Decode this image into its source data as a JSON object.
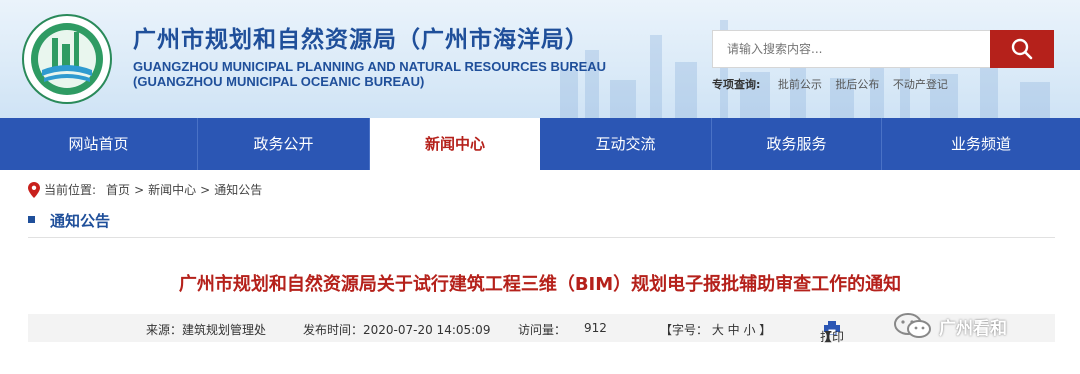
{
  "header": {
    "title_cn": "广州市规划和自然资源局（广州市海洋局）",
    "title_en_line1": "GUANGZHOU MUNICIPAL PLANNING AND NATURAL RESOURCES BUREAU",
    "title_en_line2": "(GUANGZHOU MUNICIPAL OCEANIC BUREAU)",
    "logo_icon": "bureau-emblem-icon"
  },
  "search": {
    "placeholder": "请输入搜索内容...",
    "button_icon": "search-icon",
    "button_color": "#b5211b"
  },
  "special_query": {
    "label": "专项查询:",
    "links": [
      "批前公示",
      "批后公布",
      "不动产登记"
    ]
  },
  "nav": {
    "items": [
      {
        "label": "网站首页"
      },
      {
        "label": "政务公开"
      },
      {
        "label": "新闻中心"
      },
      {
        "label": "互动交流"
      },
      {
        "label": "政务服务"
      },
      {
        "label": "业务频道"
      }
    ],
    "active_index": 2,
    "bg_color": "#2b56b4"
  },
  "breadcrumb": {
    "prefix": "当前位置:",
    "items": [
      "首页",
      "新闻中心",
      "通知公告"
    ],
    "separator": ">"
  },
  "section": {
    "title": "通知公告"
  },
  "article": {
    "title": "广州市规划和自然资源局关于试行建筑工程三维（BIM）规划电子报批辅助审查工作的通知"
  },
  "meta": {
    "source": "来源：建筑规划管理处",
    "published": "发布时间：2020-07-20 14:05:09",
    "views_label": "访问量：",
    "views": "912",
    "fontsize": "【字号：  大  中  小  】",
    "print_open": "【",
    "print_label": "打印",
    "print_close": "】",
    "print_icon": "printer-icon"
  },
  "watermark": {
    "text": "广州看和",
    "icon": "wechat-icon"
  }
}
